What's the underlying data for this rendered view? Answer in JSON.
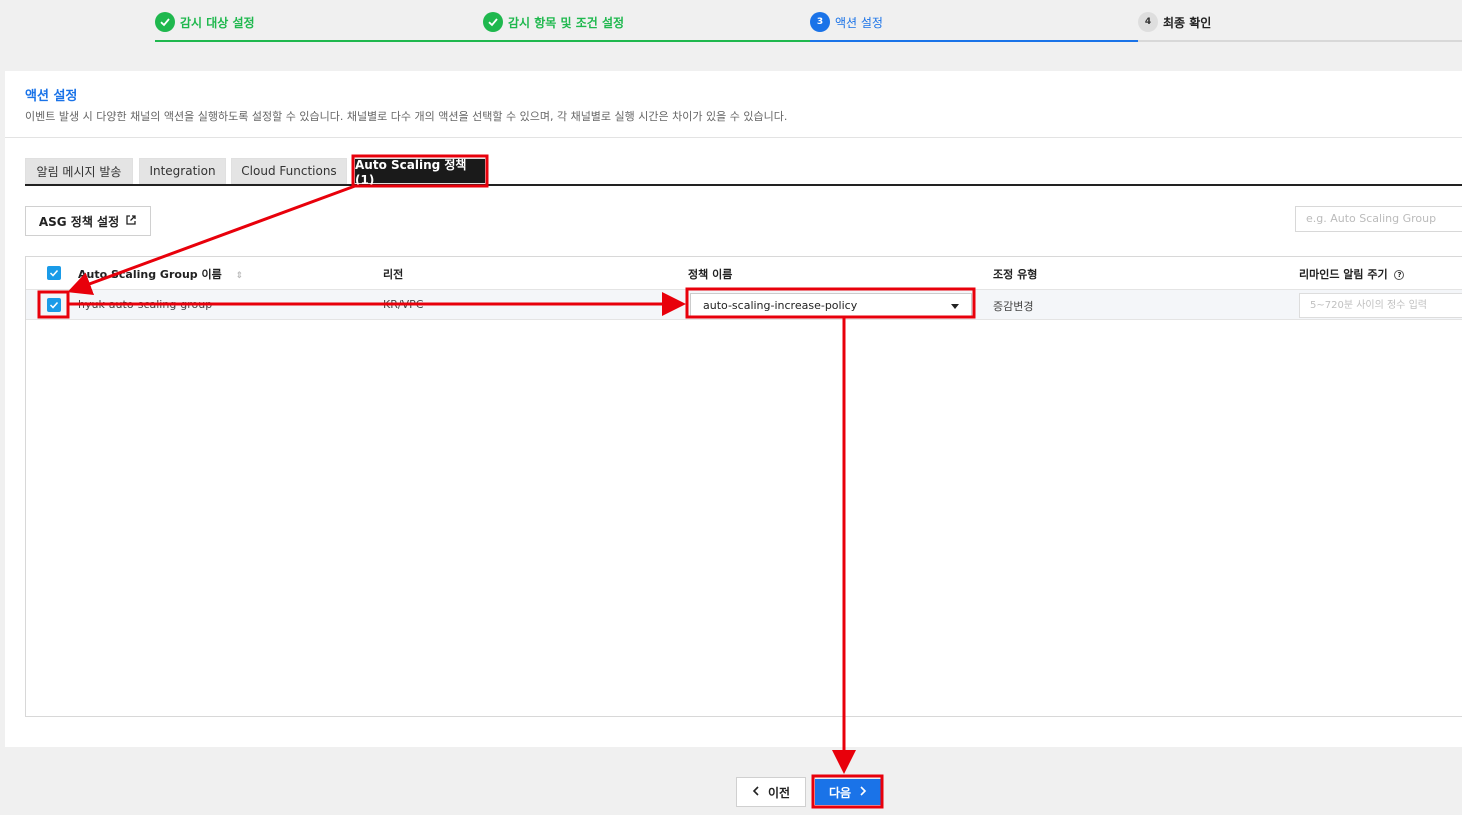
{
  "stepper": {
    "steps": [
      {
        "number": "",
        "label": "감시 대상 설정",
        "state": "done"
      },
      {
        "number": "",
        "label": "감시 항목 및 조건 설정",
        "state": "done"
      },
      {
        "number": "3",
        "label": "액션 설정",
        "state": "active"
      },
      {
        "number": "4",
        "label": "최종 확인",
        "state": "todo"
      }
    ]
  },
  "section": {
    "title": "액션 설정",
    "description": "이벤트 발생 시 다양한 채널의 액션을 실행하도록 설정할 수 있습니다. 채널별로 다수 개의 액션을 선택할 수 있으며, 각 채널별로 실행 시간은 차이가 있을 수 있습니다."
  },
  "tabs": [
    {
      "label": "알림 메시지 발송",
      "active": false
    },
    {
      "label": "Integration",
      "active": false
    },
    {
      "label": "Cloud Functions",
      "active": false
    },
    {
      "label": "Auto Scaling 정책(1)",
      "active": true
    }
  ],
  "toolbar": {
    "asg_button_label": "ASG 정책 설정",
    "search_placeholder": "e.g. Auto Scaling Group"
  },
  "table": {
    "columns": [
      "Auto Scaling Group 이름",
      "리전",
      "정책 이름",
      "조정 유형",
      "리마인드 알림 주기"
    ],
    "rows": [
      {
        "checked": true,
        "group_name": "hyuk-auto-scaling-group",
        "region": "KR/VPC",
        "policy": "auto-scaling-increase-policy",
        "adjust_type": "증감변경",
        "remind_placeholder": "5~720분 사이의 정수 입력"
      }
    ]
  },
  "footer": {
    "prev_label": "이전",
    "next_label": "다음"
  },
  "colors": {
    "done": "#1fb84e",
    "active": "#1a73e8",
    "annotation": "#e8000b"
  }
}
